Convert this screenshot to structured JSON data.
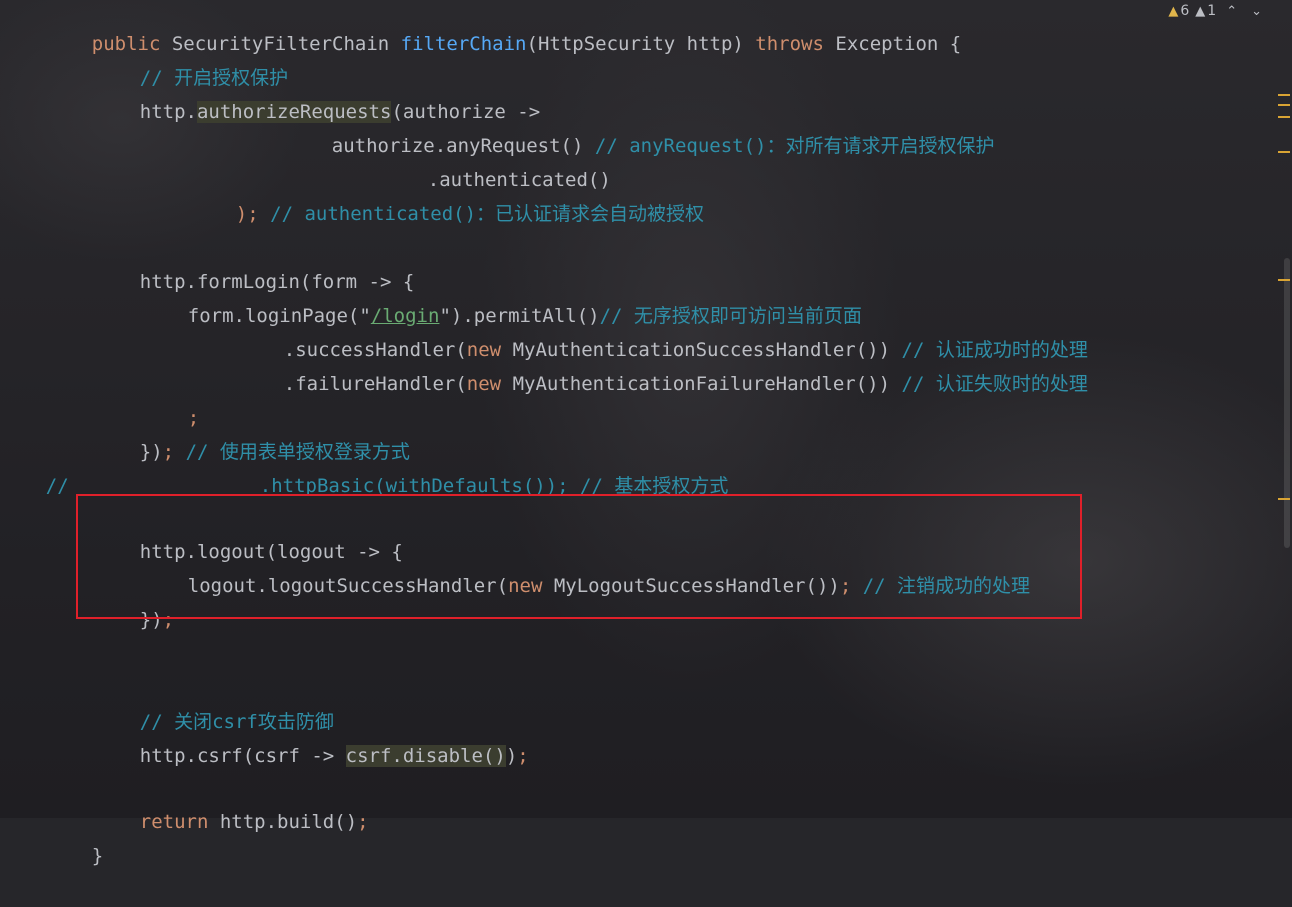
{
  "editor": {
    "indicators": {
      "warnings": "6",
      "weak_warnings": "1"
    },
    "lines": {
      "l0": {
        "t1": "public",
        "t2": "SecurityFilterChain",
        "t3": "filterChain",
        "t4": "(HttpSecurity http)",
        "t5": "throws",
        "t6": "Exception {"
      },
      "l1": {
        "comment": "// 开启授权保护"
      },
      "l2": {
        "t1": "http.",
        "t2": "authorizeRequests",
        "t3": "(authorize ->"
      },
      "l3": {
        "t1": "authorize.anyRequest()",
        "comment": "// anyRequest()：对所有请求开启授权保护"
      },
      "l4": {
        "t1": ".authenticated()"
      },
      "l5": {
        "t1": ")",
        "t2": ";",
        "comment": "// authenticated()：已认证请求会自动被授权"
      },
      "l7": {
        "t1": "http.formLogin(form -> {"
      },
      "l8": {
        "t1": "form.loginPage(\"",
        "t2": "/login",
        "t3": "\").permitAll()",
        "comment": "// 无序授权即可访问当前页面"
      },
      "l9": {
        "t1": ".successHandler(",
        "t2": "new",
        "t3": "MyAuthenticationSuccessHandler())",
        "comment": "// 认证成功时的处理"
      },
      "l10": {
        "t1": ".failureHandler(",
        "t2": "new",
        "t3": "MyAuthenticationFailureHandler())",
        "comment": "// 认证失败时的处理"
      },
      "l11": {
        "t1": ";"
      },
      "l12": {
        "t1": "})",
        "t2": ";",
        "comment": "// 使用表单授权登录方式"
      },
      "l13": {
        "t1": "//",
        "t2": ".httpBasic(withDefaults()); // 基本授权方式"
      },
      "l15": {
        "t1": "http.logout(logout -> {"
      },
      "l16": {
        "t1": "logout.logoutSuccessHandler(",
        "t2": "new",
        "t3": "MyLogoutSuccessHandler())",
        "t4": ";",
        "comment": "// 注销成功的处理"
      },
      "l17": {
        "t1": "})",
        "t2": ";"
      },
      "l20": {
        "comment": "// 关闭csrf攻击防御"
      },
      "l21": {
        "t1": "http.csrf(csrf -> ",
        "t2": "csrf.disable()",
        "t3": ")",
        "t4": ";"
      },
      "l23": {
        "t1": "return",
        "t2": "http.build()",
        "t3": ";"
      },
      "l24": {
        "t1": "}"
      }
    }
  },
  "colors": {
    "keyword": "#cf8e6d",
    "identifier": "#bcbec4",
    "method": "#56a8f5",
    "comment": "#5f826b",
    "string": "#6aab73",
    "highlight_box": "#e0202a"
  }
}
